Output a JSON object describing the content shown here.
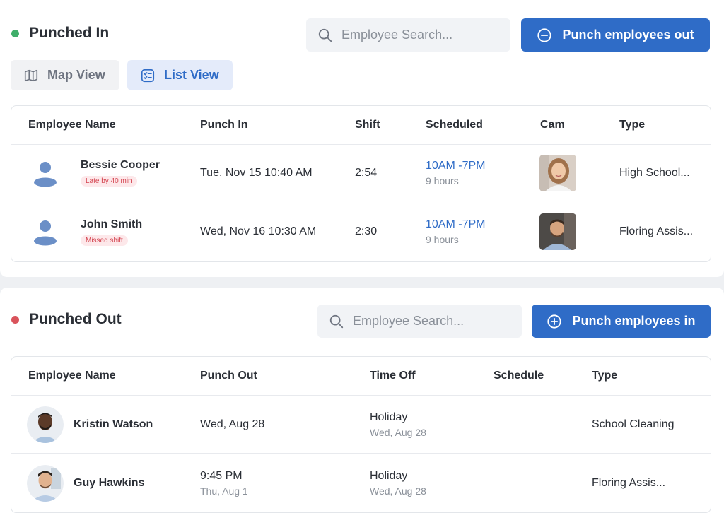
{
  "punched_in": {
    "title": "Punched In",
    "status_color": "#3fae6a",
    "search_placeholder": "Employee Search...",
    "action_label": "Punch employees out",
    "view_toggle": {
      "map_label": "Map View",
      "list_label": "List View",
      "active": "List View"
    },
    "columns": [
      "Employee Name",
      "Punch In",
      "Shift",
      "Scheduled",
      "Cam",
      "Type"
    ],
    "rows": [
      {
        "name": "Bessie Cooper",
        "badge": "Late by 40 min",
        "punch_in": "Tue, Nov 15 10:40 AM",
        "shift": "2:54",
        "scheduled": "10AM -7PM",
        "scheduled_sub": "9 hours",
        "type": "High School..."
      },
      {
        "name": "John Smith",
        "badge": "Missed shift",
        "punch_in": "Wed, Nov 16 10:30 AM",
        "shift": "2:30",
        "scheduled": "10AM -7PM",
        "scheduled_sub": "9 hours",
        "type": "Floring Assis..."
      }
    ]
  },
  "punched_out": {
    "title": "Punched Out",
    "status_color": "#d9535b",
    "search_placeholder": "Employee Search...",
    "action_label": "Punch employees in",
    "columns": [
      "Employee Name",
      "Punch Out",
      "Time Off",
      "Schedule",
      "Type"
    ],
    "rows": [
      {
        "name": "Kristin Watson",
        "punch_out": "Wed, Aug 28",
        "punch_out_sub": "",
        "time_off": "Holiday",
        "time_off_sub": "Wed, Aug 28",
        "schedule": "",
        "type": "School Cleaning"
      },
      {
        "name": "Guy Hawkins",
        "punch_out": "9:45 PM",
        "punch_out_sub": "Thu, Aug 1",
        "time_off": "Holiday",
        "time_off_sub": "Wed, Aug 28",
        "schedule": "",
        "type": "Floring Assis..."
      }
    ]
  },
  "colors": {
    "primary": "#2f6cc7",
    "late_badge_bg": "#fde8ea",
    "late_badge_text": "#d4434f"
  },
  "icons": {
    "search": "search-icon",
    "minus_circle": "minus-circle-icon",
    "plus_circle": "plus-circle-icon",
    "map": "map-icon",
    "list": "checklist-icon"
  }
}
